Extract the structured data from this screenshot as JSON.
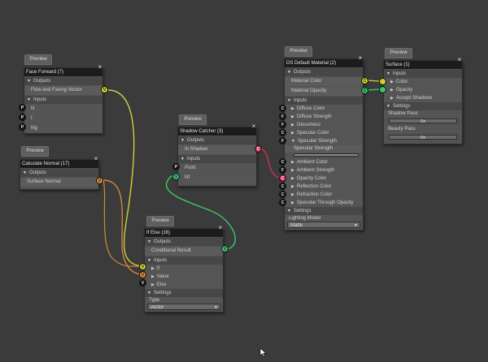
{
  "preview_label": "Preview",
  "face_forward": {
    "title": "Face Forward (7)",
    "outputs_label": "Outputs",
    "output": "Flow and Facing Vector",
    "output_socket": "V",
    "inputs_label": "Inputs",
    "inputs": [
      {
        "socket": "P",
        "label": "N"
      },
      {
        "socket": "P",
        "label": "I"
      },
      {
        "socket": "P",
        "label": "Ng"
      }
    ]
  },
  "calc_normal": {
    "title": "Calculate Normal (17)",
    "outputs_label": "Outputs",
    "output": "Surface Normal",
    "output_socket": "V"
  },
  "shadow_catcher": {
    "title": "Shadow Catcher (3)",
    "outputs_label": "Outputs",
    "output": "In Shadow",
    "output_socket": "C",
    "inputs_label": "Inputs",
    "inputs": [
      {
        "socket": "P",
        "label": "Point"
      },
      {
        "socket": "V",
        "label": "Nf"
      }
    ]
  },
  "ifelse": {
    "title": "If Else (16)",
    "outputs_label": "Outputs",
    "output": "Conditional Result",
    "output_socket": "V",
    "inputs_label": "Inputs",
    "inputs": [
      {
        "socket": "V",
        "label": "If"
      },
      {
        "socket": "V",
        "label": "Value"
      },
      {
        "socket": "V",
        "label": "Else"
      }
    ],
    "settings_label": "Settings",
    "type_label": "Type",
    "type_value": "vector"
  },
  "ds_material": {
    "title": "DS Default Material (2)",
    "outputs_label": "Outputs",
    "outputs": [
      {
        "socket": "C",
        "label": "Material Color"
      },
      {
        "socket": "C",
        "label": "Material Opacity"
      }
    ],
    "inputs_label": "Inputs",
    "inputs": [
      {
        "socket": "C",
        "label": "Diffuse Color"
      },
      {
        "socket": "F",
        "label": "Diffuse Strength"
      },
      {
        "socket": "F",
        "label": "Glossiness"
      },
      {
        "socket": "C",
        "label": "Specular Color"
      },
      {
        "socket": "F",
        "label": "Specular Strength"
      }
    ],
    "spec_strength_label": "Specular Strength",
    "spec_strength_value": 1,
    "inputs2": [
      {
        "socket": "C",
        "label": "Ambient Color"
      },
      {
        "socket": "F",
        "label": "Ambient Strength"
      },
      {
        "socket": "C",
        "label": "Opacity Color"
      },
      {
        "socket": "C",
        "label": "Reflection Color"
      },
      {
        "socket": "C",
        "label": "Refraction Color"
      },
      {
        "socket": "C",
        "label": "Specular Through Opacity"
      }
    ],
    "settings_label": "Settings",
    "lighting_label": "Lighting Model",
    "lighting_value": "Matte"
  },
  "surface": {
    "title": "Surface (1)",
    "inputs_label": "Inputs",
    "inputs": [
      "Color",
      "Opacity",
      "Accept Shadows"
    ],
    "settings_label": "Settings",
    "shadow_pass_label": "Shadow Pass",
    "shadow_pass_value": "On",
    "beauty_pass_label": "Beauty Pass",
    "beauty_pass_value": "On"
  },
  "colors": {
    "wire_yellow": "#d2cf3a",
    "wire_orange": "#cf8a3a",
    "wire_green": "#3cc866",
    "wire_red": "#c8345a"
  }
}
